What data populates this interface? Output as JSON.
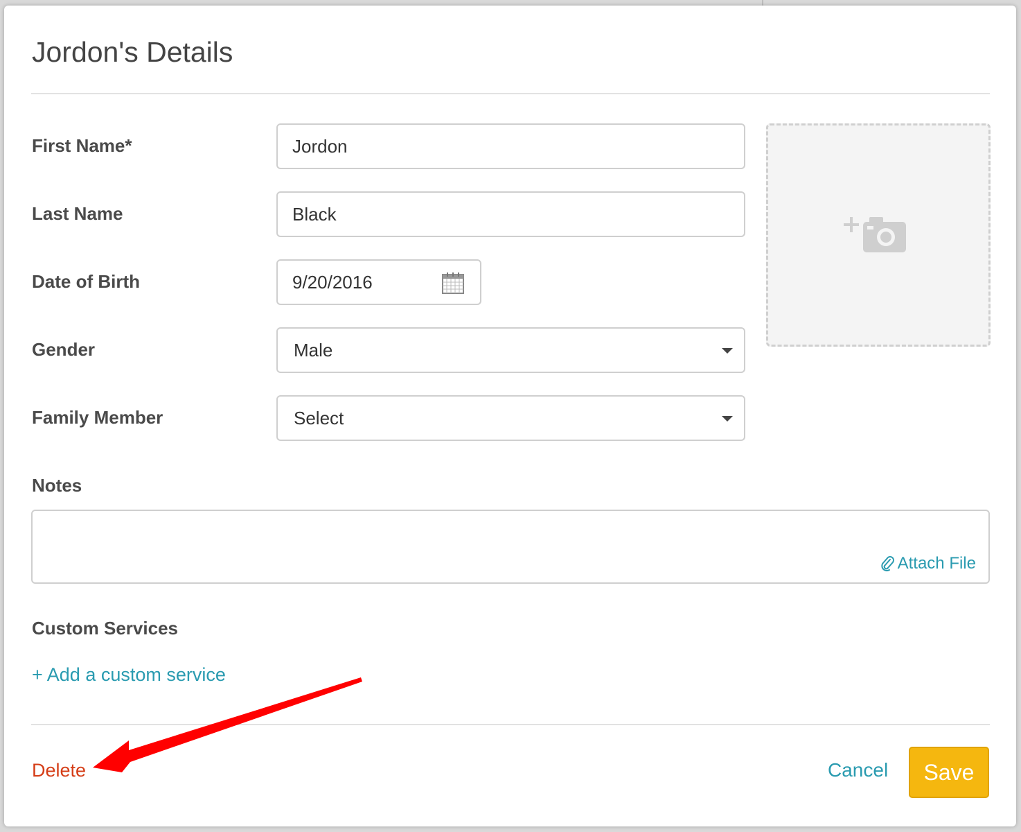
{
  "modal": {
    "title": "Jordon's Details"
  },
  "form": {
    "first_name_label": "First Name*",
    "first_name_value": "Jordon",
    "last_name_label": "Last Name",
    "last_name_value": "Black",
    "dob_label": "Date of Birth",
    "dob_value": "9/20/2016",
    "gender_label": "Gender",
    "gender_value": "Male",
    "family_member_label": "Family Member",
    "family_member_value": "Select",
    "notes_label": "Notes",
    "attach_label": "Attach File",
    "custom_services_label": "Custom Services",
    "add_custom_service_label": "+ Add a custom service"
  },
  "footer": {
    "delete_label": "Delete",
    "cancel_label": "Cancel",
    "save_label": "Save"
  },
  "icons": {
    "calendar": "calendar-icon",
    "add_photo": "add-photo-icon",
    "paperclip": "paperclip-icon",
    "dropdown": "chevron-down-icon",
    "annotation": "red-arrow-annotation"
  },
  "colors": {
    "accent_link": "#2a9bb0",
    "delete": "#d53d17",
    "save_button": "#f5b70f",
    "annotation_arrow": "#ff0000"
  }
}
